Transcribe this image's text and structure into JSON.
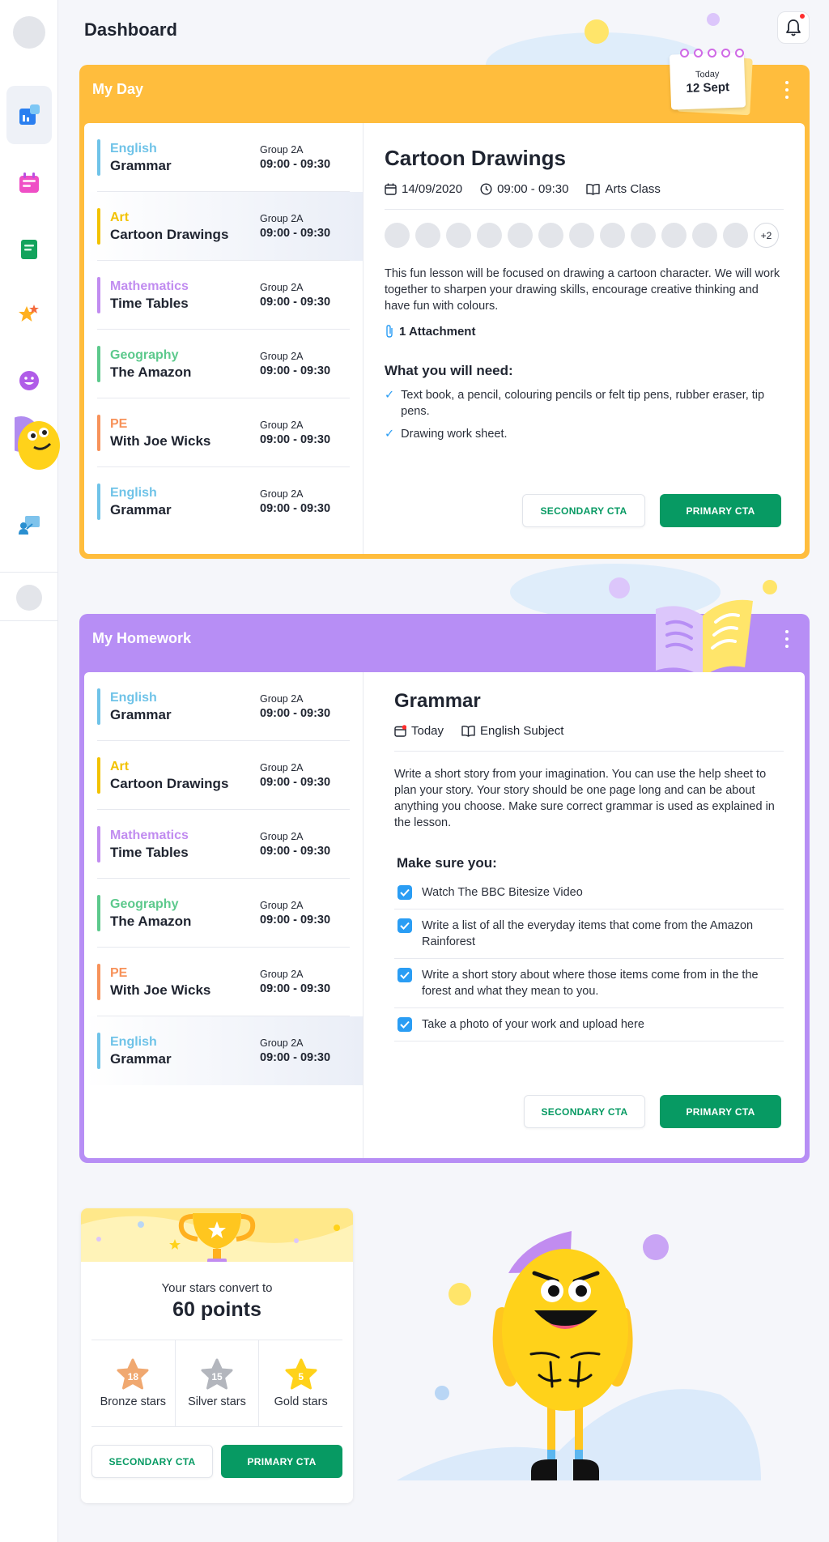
{
  "header": {
    "title": "Dashboard"
  },
  "sidebar": {
    "items": [
      {
        "icon": "dashboard-icon",
        "active": true
      },
      {
        "icon": "calendar-icon"
      },
      {
        "icon": "homework-book-icon"
      },
      {
        "icon": "stars-icon"
      },
      {
        "icon": "smiley-icon"
      },
      {
        "icon": "teacher-board-icon"
      }
    ]
  },
  "my_day": {
    "title": "My Day",
    "date_badge": {
      "label": "Today",
      "date": "12 Sept"
    },
    "lessons": [
      {
        "subject": "English",
        "topic": "Grammar",
        "group": "Group 2A",
        "time": "09:00 - 09:30",
        "color": "#6fc3e8"
      },
      {
        "subject": "Art",
        "topic": "Cartoon Drawings",
        "group": "Group 2A",
        "time": "09:00 - 09:30",
        "color": "#f2c200"
      },
      {
        "subject": "Mathematics",
        "topic": "Time Tables",
        "group": "Group 2A",
        "time": "09:00 - 09:30",
        "color": "#c18cf0"
      },
      {
        "subject": "Geography",
        "topic": "The Amazon",
        "group": "Group 2A",
        "time": "09:00 - 09:30",
        "color": "#5cc98c"
      },
      {
        "subject": "PE",
        "topic": "With Joe Wicks",
        "group": "Group 2A",
        "time": "09:00 - 09:30",
        "color": "#f7925a"
      },
      {
        "subject": "English",
        "topic": "Grammar",
        "group": "Group 2A",
        "time": "09:00 - 09:30",
        "color": "#6fc3e8"
      }
    ],
    "detail": {
      "title": "Cartoon Drawings",
      "date": "14/09/2020",
      "time": "09:00 - 09:30",
      "class": "Arts Class",
      "more_count": "+2",
      "description": "This fun lesson will be focused on drawing a cartoon character. We will work together to sharpen your drawing skills, encourage creative thinking and have fun with colours.",
      "attachment": "1 Attachment",
      "need_title": "What you will need:",
      "needs": [
        "Text book, a pencil, colouring pencils or felt tip pens, rubber eraser, tip pens.",
        "Drawing work sheet."
      ],
      "secondary_cta": "SECONDARY CTA",
      "primary_cta": "PRIMARY CTA"
    }
  },
  "my_homework": {
    "title": "My Homework",
    "lessons": [
      {
        "subject": "English",
        "topic": "Grammar",
        "group": "Group 2A",
        "time": "09:00 - 09:30",
        "color": "#6fc3e8"
      },
      {
        "subject": "Art",
        "topic": "Cartoon Drawings",
        "group": "Group 2A",
        "time": "09:00 - 09:30",
        "color": "#f2c200"
      },
      {
        "subject": "Mathematics",
        "topic": "Time Tables",
        "group": "Group 2A",
        "time": "09:00 - 09:30",
        "color": "#c18cf0"
      },
      {
        "subject": "Geography",
        "topic": "The Amazon",
        "group": "Group 2A",
        "time": "09:00 - 09:30",
        "color": "#5cc98c"
      },
      {
        "subject": "PE",
        "topic": "With Joe Wicks",
        "group": "Group 2A",
        "time": "09:00 - 09:30",
        "color": "#f7925a"
      },
      {
        "subject": "English",
        "topic": "Grammar",
        "group": "Group 2A",
        "time": "09:00 - 09:30",
        "color": "#6fc3e8"
      }
    ],
    "detail": {
      "title": "Grammar",
      "due": "Today",
      "subject": "English Subject",
      "description": "Write a short story from your imagination. You can use the help sheet to plan your story. Your story should be one page long and can be about anything you choose. Make sure correct grammar is used as explained in the lesson.",
      "checklist_title": "Make sure you:",
      "checklist": [
        "Watch The BBC Bitesize Video",
        "Write a list of all the everyday items that come from the Amazon Rainforest",
        "Write a short story about where those items come from in the the forest and what they mean to you.",
        "Take a photo of your work and upload here"
      ],
      "secondary_cta": "SECONDARY CTA",
      "primary_cta": "PRIMARY CTA"
    }
  },
  "stars": {
    "convert_text": "Your stars convert to",
    "points": "60 points",
    "items": [
      {
        "count": "18",
        "label": "Bronze stars",
        "color": "#f0a870"
      },
      {
        "count": "15",
        "label": "Silver stars",
        "color": "#b3b6bd"
      },
      {
        "count": "5",
        "label": "Gold stars",
        "color": "#ffd21a"
      }
    ],
    "secondary_cta": "SECONDARY CTA",
    "primary_cta": "PRIMARY CTA"
  },
  "colors": {
    "my_day": "#ffbd3d",
    "my_homework": "#b78ef5",
    "primary": "#079a63",
    "checkbox": "#2a9df4"
  }
}
